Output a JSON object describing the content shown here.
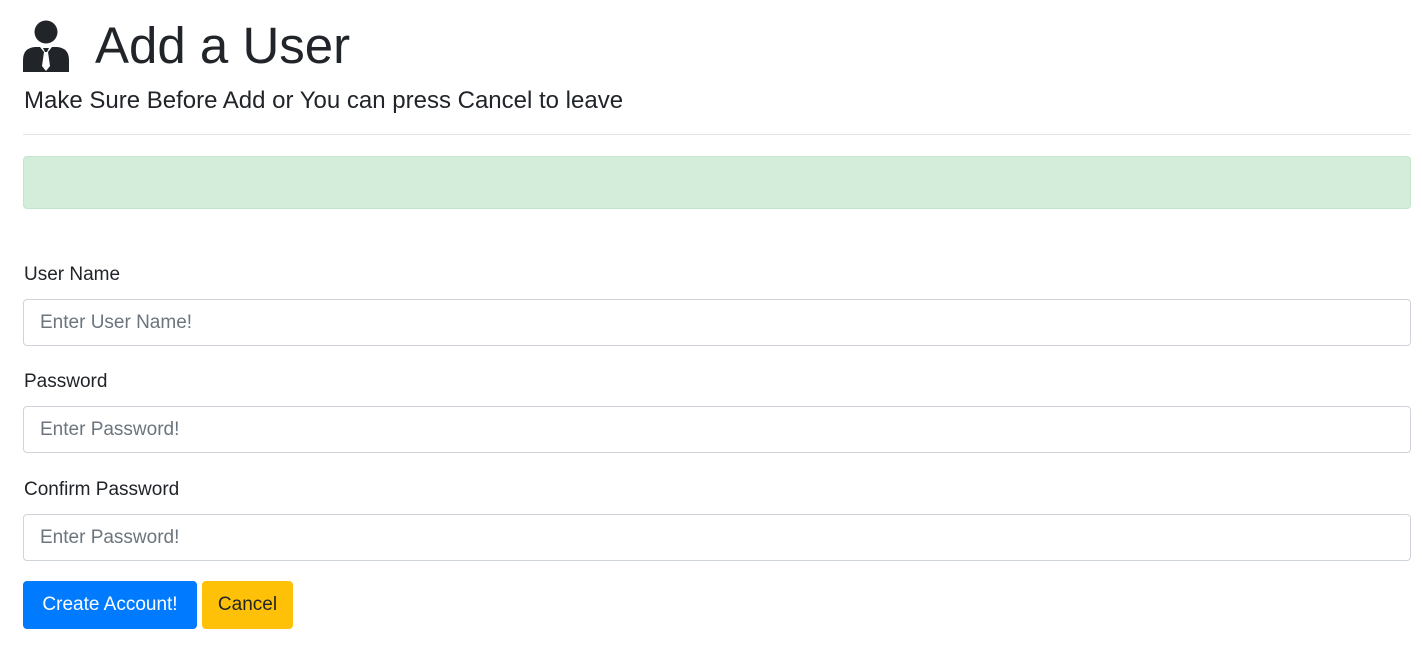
{
  "header": {
    "icon": "user-tie-icon",
    "title": "Add a User",
    "subtitle": "Make Sure Before Add or You can press Cancel to leave"
  },
  "alert": {
    "text": "",
    "color": "#d4edda"
  },
  "form": {
    "username": {
      "label": "User Name",
      "placeholder": "Enter User Name!",
      "value": ""
    },
    "password": {
      "label": "Password",
      "placeholder": "Enter Password!",
      "value": ""
    },
    "confirm_password": {
      "label": "Confirm Password",
      "placeholder": "Enter Password!",
      "value": ""
    }
  },
  "actions": {
    "create_label": "Create Account!",
    "create_color": "#007bff",
    "cancel_label": "Cancel",
    "cancel_color": "#ffc107"
  }
}
